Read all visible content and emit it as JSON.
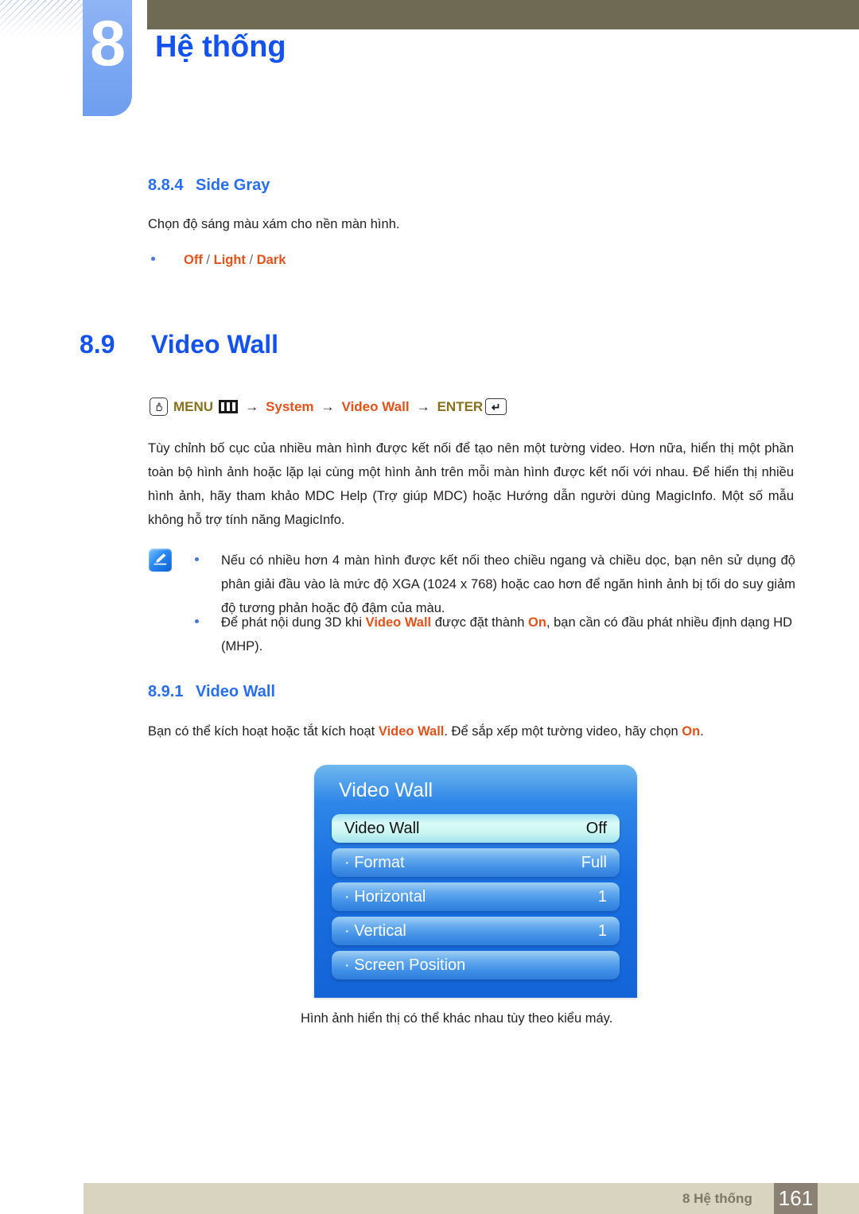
{
  "header": {
    "chapter_number": "8",
    "chapter_title": "Hệ thống"
  },
  "sections": {
    "side_gray": {
      "number": "8.8.4",
      "title": "Side Gray",
      "description": "Chọn độ sáng màu xám cho nền màn hình.",
      "options": {
        "off": "Off",
        "sep1": "/",
        "light": "Light",
        "sep2": "/",
        "dark": "Dark"
      }
    },
    "video_wall": {
      "number": "8.9",
      "title": "Video Wall",
      "menu_path": {
        "menu_label": "MENU",
        "arrow1": "→",
        "system_label": "System",
        "arrow2": "→",
        "video_wall_label": "Video Wall",
        "arrow3": "→",
        "enter_label": "ENTER",
        "enter_glyph": "↵"
      },
      "paragraph": "Tùy chỉnh bố cục của nhiều màn hình được kết nối để tạo nên một tường video. Hơn nữa, hiển thị một phần toàn bộ hình ảnh hoặc lặp lại cùng một hình ảnh trên mỗi màn hình được kết nối với nhau. Để hiển thị nhiều hình ảnh, hãy tham khảo MDC Help (Trợ giúp MDC) hoặc Hướng dẫn người dùng MagicInfo. Một số mẫu không hỗ trợ tính năng MagicInfo.",
      "notes": [
        {
          "text_before": "Nếu có nhiều hơn 4 màn hình được kết nối theo chiều ngang và chiều dọc, bạn nên sử dụng độ phân giải đầu vào là mức độ XGA (1024 x 768) hoặc cao hơn để ngăn hình ảnh bị tối do suy giảm độ tương phản hoặc độ đậm của màu."
        },
        {
          "part1": "Để phát nội dung 3D khi ",
          "hl1": "Video Wall",
          "part2": " được đặt thành ",
          "hl2": "On",
          "part3": ", bạn cần có đầu phát nhiều định dạng HD (MHP)."
        }
      ]
    },
    "video_wall_sub": {
      "number": "8.9.1",
      "title": "Video Wall",
      "text_part1": "Bạn có thể kích hoạt hoặc tắt kích hoạt ",
      "text_hl1": "Video Wall",
      "text_part2": ". Để sắp xếp một tường video, hãy chọn ",
      "text_hl2": "On",
      "text_part3": "."
    }
  },
  "osd": {
    "title": "Video Wall",
    "rows": [
      {
        "label": "Video Wall",
        "value": "Off",
        "selected": true
      },
      {
        "label": "· Format",
        "value": "Full",
        "selected": false
      },
      {
        "label": "· Horizontal",
        "value": "1",
        "selected": false
      },
      {
        "label": "· Vertical",
        "value": "1",
        "selected": false
      },
      {
        "label": "· Screen Position",
        "value": "",
        "selected": false
      }
    ],
    "caption": "Hình ảnh hiển thị có thể khác nhau tùy theo kiểu máy."
  },
  "footer": {
    "label": "8 Hệ thống",
    "page": "161"
  },
  "colors": {
    "heading_blue": "#1452f0",
    "subheading_blue": "#2a6ef0",
    "accent_orange": "#e2521b",
    "menu_olive": "#87711d",
    "topbar_olive": "#6e6a53",
    "footer_beige": "#d8d4c0",
    "footer_page_bg": "#8a8174",
    "tab_blue": "#7ba7f2"
  }
}
